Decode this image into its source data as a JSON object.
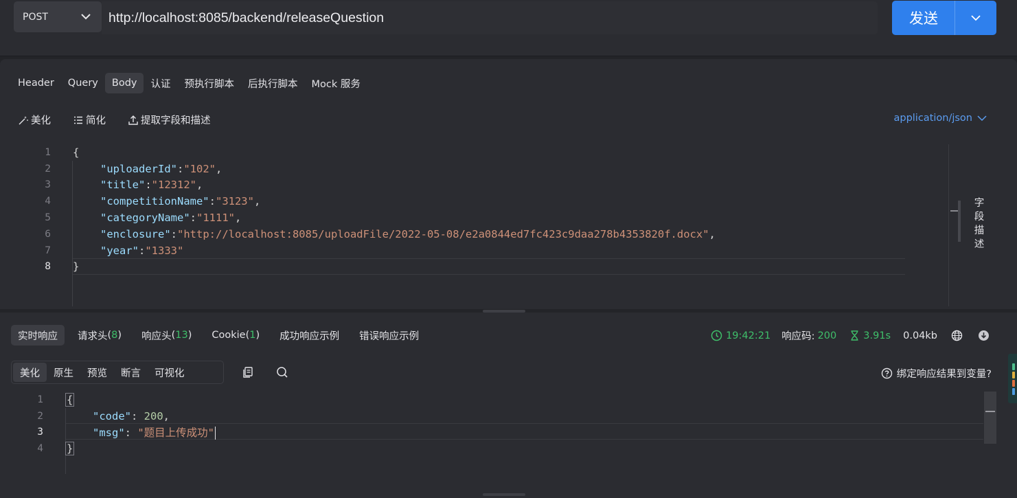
{
  "request": {
    "method": "POST",
    "url": "http://localhost:8085/backend/releaseQuestion",
    "send_label": "发送"
  },
  "tabs": [
    {
      "label": "Header",
      "active": false
    },
    {
      "label": "Query",
      "active": false
    },
    {
      "label": "Body",
      "active": true
    },
    {
      "label": "认证",
      "active": false
    },
    {
      "label": "预执行脚本",
      "active": false
    },
    {
      "label": "后执行脚本",
      "active": false
    },
    {
      "label": "Mock 服务",
      "active": false
    }
  ],
  "body_tools": {
    "beautify": "美化",
    "simplify": "简化",
    "extract": "提取字段和描述",
    "content_type": "application/json"
  },
  "field_desc_label": "字段描述",
  "request_body": {
    "line_numbers": [
      "1",
      "2",
      "3",
      "4",
      "5",
      "6",
      "7",
      "8"
    ],
    "open_brace": "{",
    "close_brace": "}",
    "fields": [
      {
        "key": "\"uploaderId\"",
        "value": "\"102\"",
        "trail": ","
      },
      {
        "key": "\"title\"",
        "value": "\"12312\"",
        "trail": ","
      },
      {
        "key": "\"competitionName\"",
        "value": "\"3123\"",
        "trail": ","
      },
      {
        "key": "\"categoryName\"",
        "value": "\"1111\"",
        "trail": ","
      },
      {
        "key": "\"enclosure\"",
        "value": "\"http://localhost:8085/uploadFile/2022-05-08/e2a0844ed7fc423c9daa278b4353820f.docx\"",
        "trail": ","
      },
      {
        "key": "\"year\"",
        "value": "\"1333\"",
        "trail": ""
      }
    ]
  },
  "response_tabs": {
    "realtime": "实时响应",
    "req_headers": "请求头",
    "req_headers_count": "8",
    "resp_headers": "响应头",
    "resp_headers_count": "13",
    "cookie": "Cookie",
    "cookie_count": "1",
    "success_example": "成功响应示例",
    "error_example": "错误响应示例",
    "paren_open": "(",
    "paren_close": ")"
  },
  "response_meta": {
    "time": "19:42:21",
    "status_label": "响应码:",
    "status_code": "200",
    "duration": "3.91s",
    "size": "0.04kb"
  },
  "response_views": [
    {
      "label": "美化",
      "active": true
    },
    {
      "label": "原生",
      "active": false
    },
    {
      "label": "预览",
      "active": false
    },
    {
      "label": "断言",
      "active": false
    },
    {
      "label": "可视化",
      "active": false
    }
  ],
  "bind_label": "绑定响应结果到变量?",
  "response_body": {
    "line_numbers": [
      "1",
      "2",
      "3",
      "4"
    ],
    "open_brace": "{",
    "close_brace": "}",
    "code_key": "\"code\"",
    "code_value": "200",
    "msg_key": "\"msg\"",
    "msg_value": "\"题目上传成功\""
  },
  "colors": {
    "accent": "#2f80ed",
    "success": "#3fbf6a",
    "json_key": "#9cdcfe",
    "json_string": "#ce9178",
    "json_number": "#b5cea8"
  }
}
